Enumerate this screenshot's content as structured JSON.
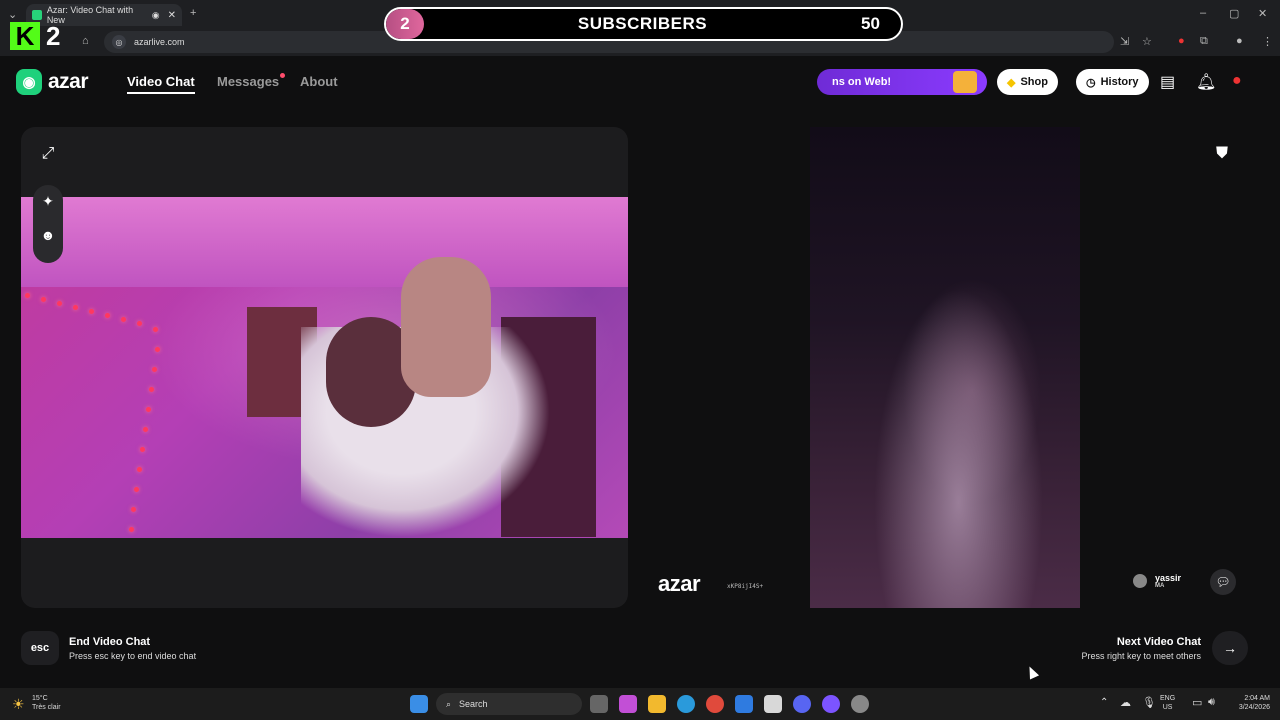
{
  "browser": {
    "tab_title": "Azar: Video Chat with New",
    "url": "azarlive.com"
  },
  "stream_overlay": {
    "kick_number": "2",
    "badge_number": "2",
    "label": "SUBSCRIBERS",
    "count": "50"
  },
  "nav": {
    "logo_text": "azar",
    "links": [
      "Video Chat",
      "Messages",
      "About"
    ],
    "promo_text": "ns on Web!",
    "shop_label": "Shop",
    "history_label": "History"
  },
  "video": {
    "watermark": "azar",
    "watermark_id": "xKP8ijI4S+",
    "partner_name": "yassir",
    "partner_country": "MA"
  },
  "controls": {
    "esc_label": "esc",
    "end_title": "End Video Chat",
    "end_sub": "Press esc key to end video chat",
    "next_title": "Next Video Chat",
    "next_sub": "Press right key to meet others"
  },
  "taskbar": {
    "temp": "15°C",
    "weather": "Très clair",
    "search_label": "Search",
    "lang": "ENG",
    "region": "US",
    "time": "2:04 AM",
    "date": "3/24/2026"
  },
  "colors": {
    "brand": "#1fd17c",
    "promo": "#7a31e6",
    "kick": "#53fc18"
  }
}
